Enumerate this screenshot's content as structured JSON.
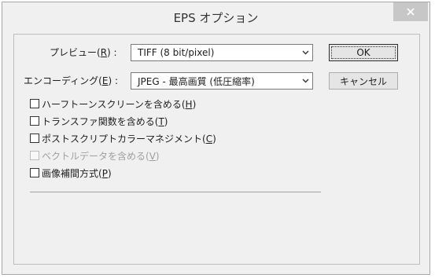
{
  "dialog": {
    "title": "EPS オプション",
    "close_label": "×"
  },
  "preview": {
    "label": "プレビュー",
    "mnemonic": "R",
    "value": "TIFF (8 bit/pixel)"
  },
  "encoding": {
    "label": "エンコーディング",
    "mnemonic": "E",
    "value": "JPEG - 最高画質 (低圧縮率)"
  },
  "buttons": {
    "ok": "OK",
    "cancel": "キャンセル"
  },
  "options": [
    {
      "label": "ハーフトーンスクリーンを含める",
      "mnemonic": "H",
      "checked": false,
      "enabled": true
    },
    {
      "label": "トランスファ関数を含める",
      "mnemonic": "T",
      "checked": false,
      "enabled": true
    },
    {
      "label": "ポストスクリプトカラーマネジメント",
      "mnemonic": "C",
      "checked": false,
      "enabled": true
    },
    {
      "label": "ベクトルデータを含める",
      "mnemonic": "V",
      "checked": false,
      "enabled": false
    },
    {
      "label": "画像補間方式",
      "mnemonic": "P",
      "checked": false,
      "enabled": true
    }
  ],
  "icons": {
    "close": "close-icon",
    "dropdown": "chevron-down-icon"
  },
  "colors": {
    "dialog_bg": "#f0f0f0",
    "close_bg": "#c7c7c7",
    "disabled_text": "#a0a0a0"
  }
}
